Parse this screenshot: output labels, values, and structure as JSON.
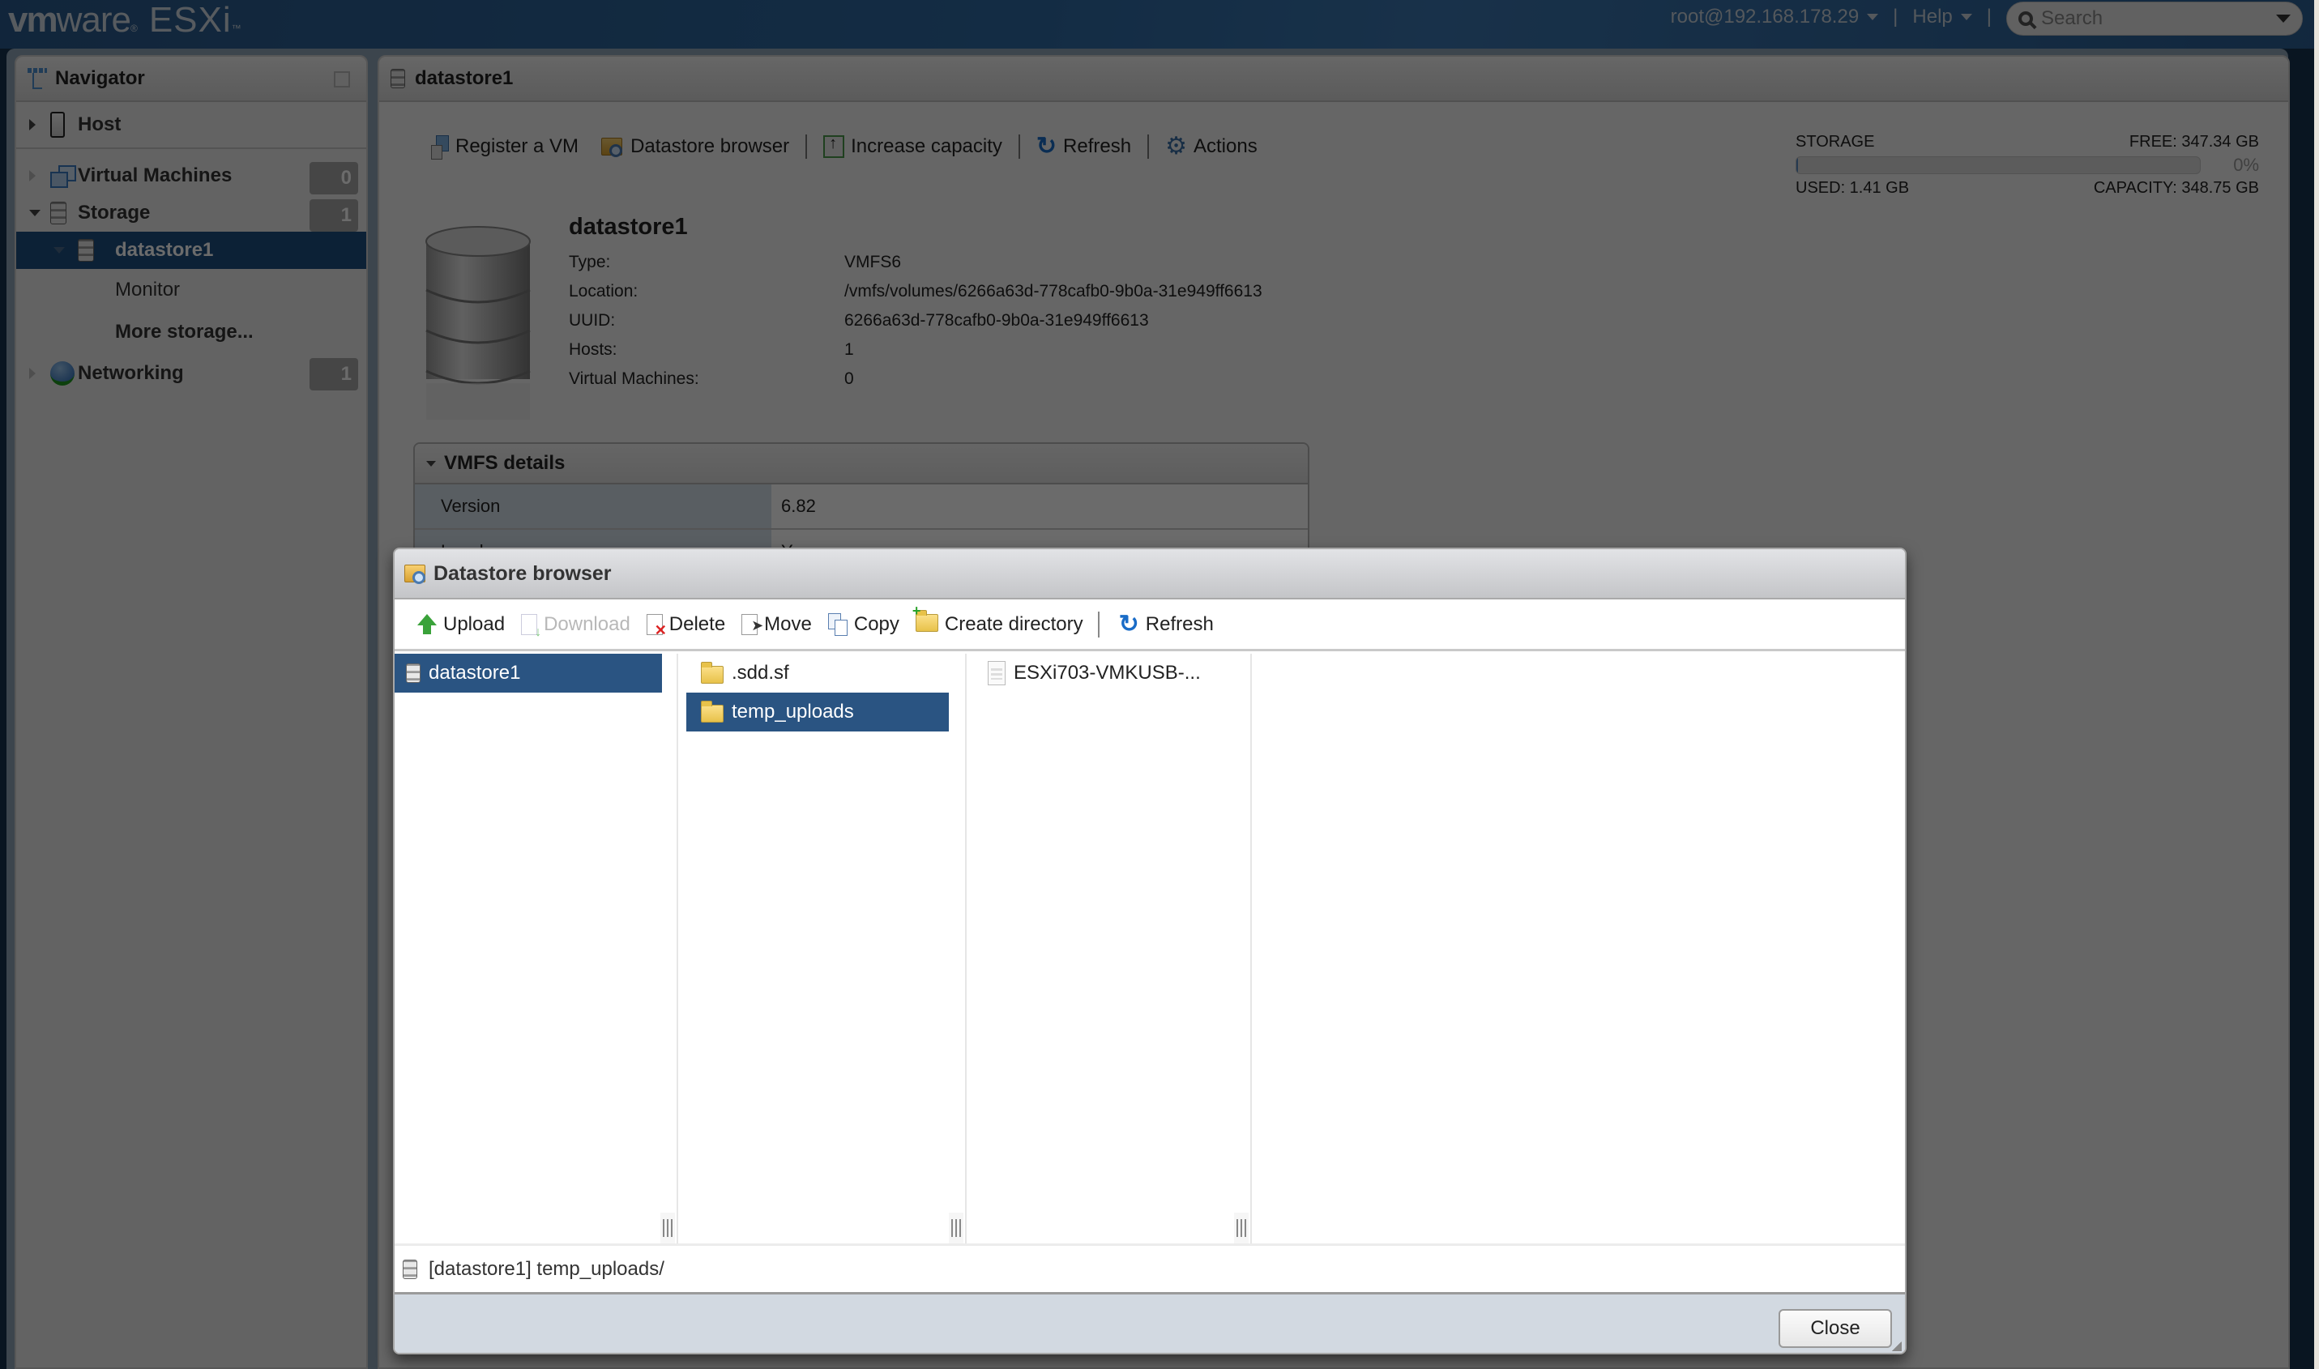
{
  "app": {
    "logo_vm": "vm",
    "logo_ware": "ware",
    "logo_reg": "®",
    "logo_product": "ESXi",
    "logo_tm": "™"
  },
  "topnav": {
    "user": "root@192.168.178.29",
    "help": "Help",
    "separator": "|",
    "search_placeholder": "Search"
  },
  "navigator": {
    "title": "Navigator",
    "items": [
      {
        "label": "Host"
      },
      {
        "label": "Virtual Machines",
        "count": "0"
      },
      {
        "label": "Storage",
        "count": "1"
      },
      {
        "label": "datastore1"
      },
      {
        "label": "Monitor"
      },
      {
        "label": "More storage..."
      },
      {
        "label": "Networking",
        "count": "1"
      }
    ]
  },
  "main": {
    "title": "datastore1",
    "toolbar": {
      "register_vm": "Register a VM",
      "datastore_browser": "Datastore browser",
      "increase_capacity": "Increase capacity",
      "refresh": "Refresh",
      "actions": "Actions"
    },
    "storage": {
      "label": "STORAGE",
      "free": "FREE: 347.34 GB",
      "used": "USED: 1.41 GB",
      "capacity": "CAPACITY: 348.75 GB",
      "percent_label": "0%",
      "used_fraction": 0.004
    },
    "datastore": {
      "name": "datastore1",
      "properties": [
        {
          "key": "Type:",
          "value": "VMFS6"
        },
        {
          "key": "Location:",
          "value": "/vmfs/volumes/6266a63d-778cafb0-9b0a-31e949ff6613"
        },
        {
          "key": "UUID:",
          "value": "6266a63d-778cafb0-9b0a-31e949ff6613"
        },
        {
          "key": "Hosts:",
          "value": "1"
        },
        {
          "key": "Virtual Machines:",
          "value": "0"
        }
      ]
    },
    "vmfs_details": {
      "title": "VMFS details",
      "rows": [
        {
          "key": "Version",
          "value": "6.82"
        },
        {
          "key": "Local",
          "value": "Yes"
        }
      ]
    }
  },
  "dialog": {
    "title": "Datastore browser",
    "toolbar": {
      "upload": "Upload",
      "download": "Download",
      "delete": "Delete",
      "move": "Move",
      "copy": "Copy",
      "create_directory": "Create directory",
      "refresh": "Refresh"
    },
    "columns": {
      "datastores": [
        {
          "name": "datastore1",
          "selected": true
        }
      ],
      "folders": [
        {
          "name": ".sdd.sf",
          "selected": false
        },
        {
          "name": "temp_uploads",
          "selected": true
        }
      ],
      "files": [
        {
          "name": "ESXi703-VMKUSB-..."
        }
      ]
    },
    "path": "[datastore1] temp_uploads/",
    "close": "Close"
  }
}
